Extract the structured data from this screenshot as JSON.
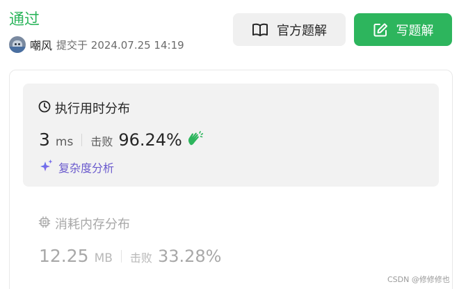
{
  "header": {
    "status": "通过",
    "username": "嘲风",
    "submitted_label": "提交于 2024.07.25 14:19"
  },
  "actions": {
    "official_solution": "官方题解",
    "write_solution": "写题解"
  },
  "runtime": {
    "title": "执行用时分布",
    "value": "3",
    "unit": "ms",
    "beats_label": "击败",
    "beats_value": "96.24%",
    "analysis_link": "复杂度分析"
  },
  "memory": {
    "title": "消耗内存分布",
    "value": "12.25",
    "unit": "MB",
    "beats_label": "击败",
    "beats_value": "33.28%"
  },
  "watermark": "CSDN @修修修也",
  "colors": {
    "accent_green": "#2db55d",
    "analysis_purple": "#6a5acd",
    "muted_gray": "#a8a8a8"
  }
}
